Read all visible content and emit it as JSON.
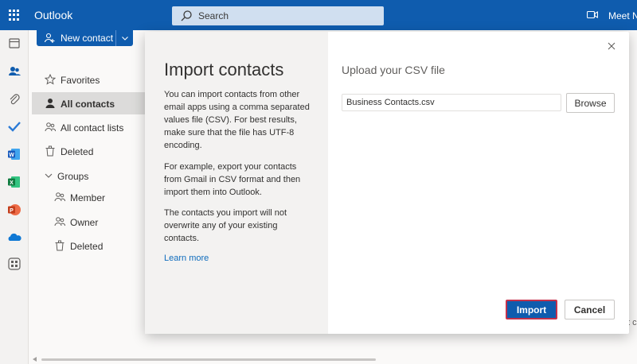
{
  "app": {
    "title": "Outlook"
  },
  "search": {
    "placeholder": "Search"
  },
  "header": {
    "meet_label": "Meet N"
  },
  "nav": {
    "new_contact_label": "New contact",
    "items": [
      {
        "label": "Favorites",
        "icon": "star-icon"
      },
      {
        "label": "All contacts",
        "icon": "person-icon",
        "selected": true
      },
      {
        "label": "All contact lists",
        "icon": "people-icon"
      },
      {
        "label": "Deleted",
        "icon": "trash-icon"
      },
      {
        "label": "Groups",
        "icon": "chevron-down-icon"
      },
      {
        "label": "Member",
        "icon": "people-icon"
      },
      {
        "label": "Owner",
        "icon": "people-icon"
      },
      {
        "label": "Deleted",
        "icon": "trash-icon"
      }
    ]
  },
  "dialog": {
    "title": "Import contacts",
    "paragraphs": [
      "You can import contacts from other email apps using a comma separated values file (CSV). For best results, make sure that the file has UTF-8 encoding.",
      "For example, export your contacts from Gmail in CSV format and then import them into Outlook.",
      "The contacts you import will not overwrite any of your existing contacts."
    ],
    "learn_more": "Learn more",
    "upload_title": "Upload your CSV file",
    "file_value": "Business Contacts.csv",
    "browse_label": "Browse",
    "import_label": "Import",
    "cancel_label": "Cancel"
  },
  "background": {
    "edge_text": "t c"
  },
  "colors": {
    "brand": "#0f5cae",
    "link": "#0f6cbd",
    "focus": "#c4314b"
  }
}
